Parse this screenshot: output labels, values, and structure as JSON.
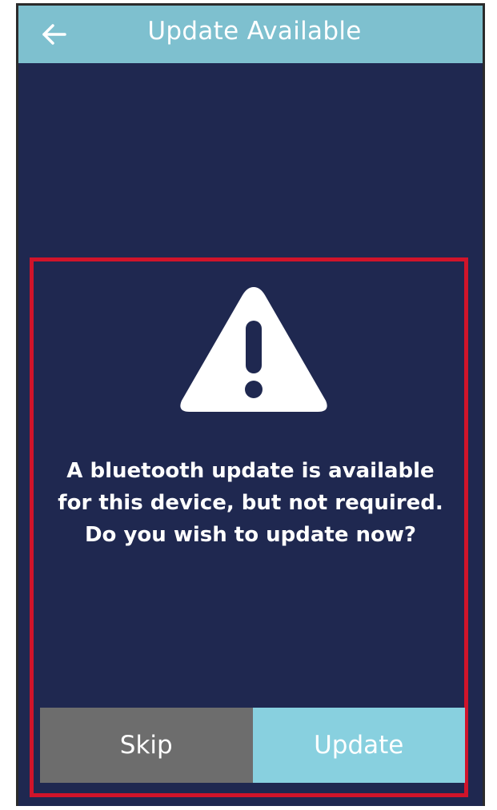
{
  "header": {
    "title": "Update Available",
    "back_icon": "back-arrow-icon"
  },
  "dialog": {
    "icon": "warning-triangle-icon",
    "message": "A bluetooth update is available for this device, but not required. Do you wish to update now?",
    "skip_label": "Skip",
    "update_label": "Update"
  },
  "colors": {
    "header_bg": "#7ec0cf",
    "screen_bg": "#1f2850",
    "highlight_border": "#d0142a",
    "skip_bg": "#6d6d6d",
    "update_bg": "#88d0df"
  }
}
